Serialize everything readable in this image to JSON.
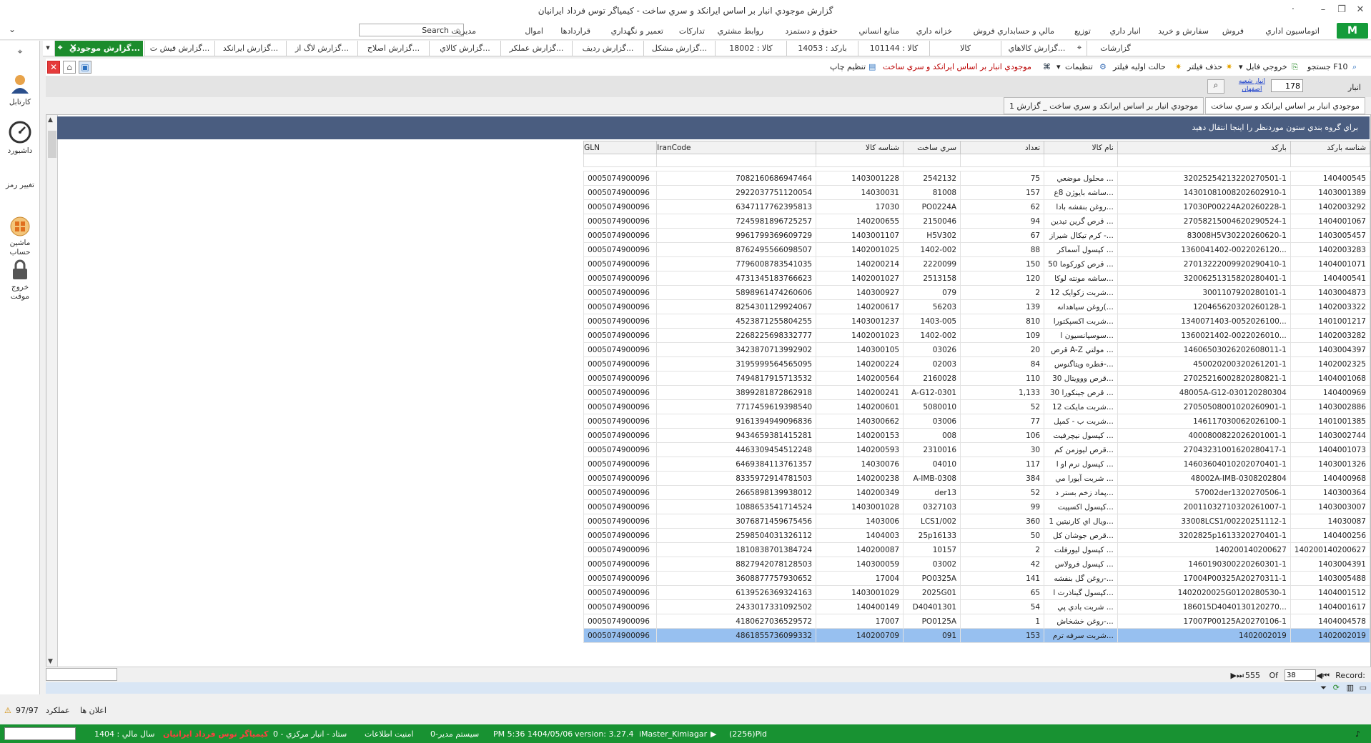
{
  "window": {
    "title": "گزارش موجودي انبار بر اساس ايرانکد و سري ساخت - کيمياگر توس فرداد ايرانيان",
    "minimize": "–",
    "restore": "❐",
    "close": "✕",
    "pin": "·"
  },
  "menu": {
    "items": [
      "اتوماسيون اداري",
      "فروش",
      "سفارش و خريد",
      "انبار داري",
      "توزيع",
      "مالي و حسابداري فروش",
      "خزانه داري",
      "منابع انساني",
      "حقوق و دستمزد",
      "روابط مشتري",
      "تدارکات",
      "تعمير و نگهداري",
      "قراردادها",
      "اموال",
      "مديريت"
    ],
    "search_label": "Search",
    "search_icon": "⌕",
    "collapse_icon": "⌄",
    "logo": "M"
  },
  "tabs": {
    "items": [
      {
        "label": "گزارشات"
      },
      {
        "label": "گزارش کالاهاي..."
      },
      {
        "label": "کالا"
      },
      {
        "label": "کالا : 101144"
      },
      {
        "label": "بارکد : 14053"
      },
      {
        "label": "کالا : 18002"
      },
      {
        "label": "گزارش مشکل..."
      },
      {
        "label": "گزارش رديف..."
      },
      {
        "label": "گزارش عملکر..."
      },
      {
        "label": "گزارش کالاي..."
      },
      {
        "label": "گزارش اصلاح..."
      },
      {
        "label": "گزارش لاگ از..."
      },
      {
        "label": "گزارش ايرانکد..."
      },
      {
        "label": "گزارش فيش ت..."
      },
      {
        "label": "گزارش موجودي..."
      }
    ],
    "pin_icon": "⌖",
    "close_icon": "×",
    "dropdown_icon": "▾"
  },
  "sidebar": {
    "collapse_icon": "⌖",
    "items": [
      {
        "label": "کارتابل",
        "color": "#e8a34a"
      },
      {
        "label": "داشبورد",
        "color": "#444444"
      },
      {
        "label": "تغيير رمز",
        "color": "#ffffff"
      },
      {
        "label": "ماشين حساب",
        "color": "#e69a2a"
      },
      {
        "label": "خروج موقت",
        "color": "#555555"
      }
    ]
  },
  "toolbar": {
    "search": "جستجو F10",
    "export": "خروجي فايل",
    "remove_filter": "حذف فيلتر",
    "initial_filter": "حالت اوليه فيلتر",
    "settings": "تنظيمات",
    "report_title": "موجودي انبار بر اساس ايرانکد و سري ساخت",
    "print": "تنظيم چاپ"
  },
  "filter": {
    "label": "انبار",
    "value": "178",
    "warehouse_line1": "انبار شعبه",
    "warehouse_line2": "اصفهان"
  },
  "report_tabs": [
    "موجودي انبار بر اساس ايرانکد و سري ساخت",
    "موجودي انبار بر اساس ايرانکد و سري ساخت _ گزارش 1"
  ],
  "group_panel_text": "براي گروه بندي ستون موردنظر را اينجا انتقال دهيد",
  "grid": {
    "columns": [
      "شناسه بارکد",
      "بارکد",
      "نام کالا",
      "تعداد",
      "سري ساخت",
      "شناسه کالا",
      "IranCode",
      "GLN"
    ],
    "rows": [
      [
        "140400545",
        "32025254213220270501-1",
        "محلول موضعي ...",
        "75",
        "2542132",
        "1403001228",
        "7082160686947464",
        "0005074900096"
      ],
      [
        "1403001389",
        "14301081008202602910-1",
        "ساشه بايوژن 8ع...",
        "157",
        "81008",
        "14030031",
        "2922037751120054",
        "0005074900096"
      ],
      [
        "1402003292",
        "17030P00224A20260228-1",
        "روغن بنفشه بادا...",
        "62",
        "PO0224A",
        "17030",
        "6347117762395813",
        "0005074900096"
      ],
      [
        "1404001067",
        "27058215004620290524-1",
        "قرص گرين تيدين ...",
        "94",
        "2150046",
        "140200655",
        "7245981896725257",
        "0005074900096"
      ],
      [
        "1403005457",
        "83008H5V30220260620-1",
        "کرم تيکال شيراز -...",
        "67",
        "H5V302",
        "1403001107",
        "9961799369609729",
        "0005074900096"
      ],
      [
        "1402003283",
        "1360041402-0022026120...",
        "کپسول آسماکر ...",
        "88",
        "1402-002",
        "1402001025",
        "8762495566098507",
        "0005074900096"
      ],
      [
        "1404001071",
        "27013222009920290410-1",
        "قرص کورکوما 50 ...",
        "150",
        "2220099",
        "140200214",
        "7796008783541035",
        "0005074900096"
      ],
      [
        "140400541",
        "32006251315820280401-1",
        "ساشه مونته لوکا...",
        "120",
        "2513158",
        "1402001027",
        "4731345183766623",
        "0005074900096"
      ],
      [
        "1403004873",
        "3001107920280101-1",
        "شربت زکوايک 12...",
        "2",
        "079",
        "140300927",
        "5898961474260606",
        "0005074900096"
      ],
      [
        "1402003322",
        "120465620320260128-1",
        "روغن سياهدانه(...",
        "139",
        "56203",
        "140200617",
        "8254301129924067",
        "0005074900096"
      ],
      [
        "1401001217",
        "1340071403-0052026100...",
        "شربت اکسپکتورا...",
        "810",
        "1403-005",
        "1403001237",
        "4523871255804255",
        "0005074900096"
      ],
      [
        "1402003282",
        "1360021402-0022026010...",
        "سوسپانسيون ا...",
        "109",
        "1402-002",
        "1402001023",
        "2268225698332777",
        "0005074900096"
      ],
      [
        "1403004397",
        "14606503026202608011-1",
        "قرص A-Z مولتي ...",
        "20",
        "03026",
        "140300105",
        "3423870713992902",
        "0005074900096"
      ],
      [
        "1402002325",
        "450020200320261201-1",
        "قطره ويتاگنوس-...",
        "84",
        "02003",
        "140200224",
        "3195999564565095",
        "0005074900096"
      ],
      [
        "1404001068",
        "27025216002820280821-1",
        "قرص ووويتال 30...",
        "110",
        "2160028",
        "140200564",
        "7494817915713532",
        "0005074900096"
      ],
      [
        "140400969",
        "48005A-G12-030120280304",
        "قرص جينکورا 30 ...",
        "1,133",
        "A-G12-0301",
        "140200241",
        "3899281872862918",
        "0005074900096"
      ],
      [
        "1403002886",
        "27050508001020260901-1",
        "شربت مايکت 12...",
        "52",
        "5080010",
        "140200601",
        "7717459619398540",
        "0005074900096"
      ],
      [
        "1401001385",
        "146117030062026100-1",
        "شربت ب - کمپل...",
        "77",
        "03006",
        "140300662",
        "9161394949096836",
        "0005074900096"
      ],
      [
        "1403002744",
        "4000800822026201001-1",
        "کپسول نيچرفيت ...",
        "106",
        "008",
        "140200153",
        "9434659381415281",
        "0005074900096"
      ],
      [
        "1404001073",
        "27043231001620280417-1",
        "قرص ليوزمن کم...",
        "30",
        "2310016",
        "140200593",
        "4463309454512248",
        "0005074900096"
      ],
      [
        "1403001326",
        "14603604010202070401-1",
        "کپسول نرم او ا ...",
        "117",
        "04010",
        "14030076",
        "6469384113761357",
        "0005074900096"
      ],
      [
        "140400968",
        "48002A-IMB-0308202804",
        "شربت آيورا مي ...",
        "384",
        "A-IMB-0308",
        "140200238",
        "8335972914781503",
        "0005074900096"
      ],
      [
        "140300364",
        "57002der1320270506-1",
        "پماد زخم بستر د...",
        "52",
        "der13",
        "140200349",
        "2665898139938012",
        "0005074900096"
      ],
      [
        "1403003007",
        "20011032710320261007-1",
        "کپسول اکسپيت...",
        "99",
        "0327103",
        "1403001028",
        "1088653541714524",
        "0005074900096"
      ],
      [
        "14030087",
        "33008LCS1/00220251112-1",
        "ويال اي کارنيتين 1...",
        "360",
        "LCS1/002",
        "1403006",
        "3076871459675456",
        "0005074900096"
      ],
      [
        "140400256",
        "3202825p1613320270401-1",
        "قرص جوشان کل...",
        "50",
        "25p16133",
        "1404003",
        "2598504031326112",
        "0005074900096"
      ],
      [
        "140200140200627",
        "140200140200627",
        "کپسول ليورفلت ...",
        "2",
        "10157",
        "140200087",
        "1810838701384724",
        "0005074900096"
      ],
      [
        "1403004391",
        "1460190300220260301-1",
        "کپسول فرولاس ...",
        "42",
        "03002",
        "140300059",
        "8827942078128503",
        "0005074900096"
      ],
      [
        "1403005488",
        "17004P00325A20270311-1",
        "روغن گل بنفشه-...",
        "141",
        "PO0325A",
        "17004",
        "3608877757930652",
        "0005074900096"
      ],
      [
        "1404001512",
        "1402020025G0120280530-1",
        "کپسول گيناذرت ا...",
        "65",
        "2025G01",
        "1403001029",
        "6139526369324163",
        "0005074900096"
      ],
      [
        "1404001617",
        "186015D4040130120270...",
        "شربت بادي پي ...",
        "54",
        "D40401301",
        "140400149",
        "2433017331092502",
        "0005074900096"
      ],
      [
        "1404004578",
        "17007P00125A20270106-1",
        "روغن خشخاش-...",
        "1",
        "PO0125A",
        "17007",
        "4180627036529572",
        "0005074900096"
      ],
      [
        "1402002019",
        "1402002019",
        "شربت سرفه ترم...",
        "153",
        "091",
        "140200709",
        "4861855736099332",
        "0005074900096"
      ]
    ],
    "selected_row": 32
  },
  "navigator": {
    "record_label": "Record:",
    "current": "38",
    "of_label": "Of",
    "total": "555"
  },
  "notifications": {
    "announcements": "اعلان ها",
    "performance": "عملکرد",
    "count": "97/97",
    "warning_icon": "⚠"
  },
  "statusbar": {
    "pid": "(2256)Pid",
    "user": "iMaster_Kimiagar",
    "version": "version: 3.27.4",
    "datetime": "PM 5:36 1404/05/06",
    "system": "سيستم مدير-0",
    "security": "امنيت اطلاعات",
    "warehouse": "ستاد - انبار مرکزي - 0",
    "company": "کيمياگر توس فرداد ايرانيان",
    "fiscal_year": "سال مالي : 1404",
    "bell_icon": "♪",
    "arrow_icon": "▶"
  }
}
